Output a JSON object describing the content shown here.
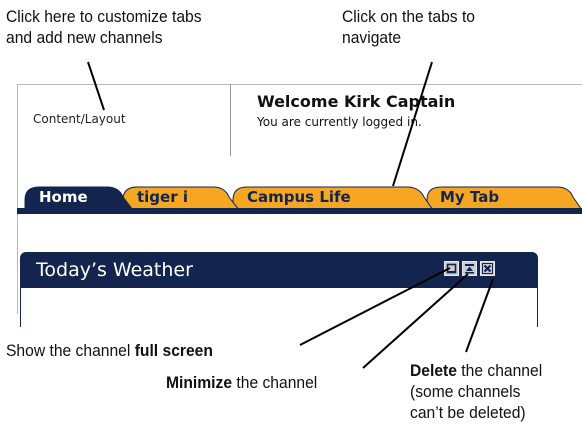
{
  "annotations": {
    "customize": [
      "Click here to customize tabs",
      "and add new channels"
    ],
    "navigate": [
      "Click on the tabs to",
      "navigate"
    ],
    "full_screen": {
      "prefix": "Show the channel ",
      "bold": "full screen"
    },
    "minimize": {
      "bold": "Minimize",
      "suffix": " the channel"
    },
    "delete": {
      "bold": "Delete",
      "suffix": " the channel",
      "line2": "(some channels",
      "line3": "can’t be deleted)"
    }
  },
  "header": {
    "content_layout_link": "Content/Layout",
    "welcome": "Welcome Kirk Captain",
    "status": "You are currently logged in."
  },
  "tabs": [
    {
      "label": "Home",
      "active": true
    },
    {
      "label": "tiger i",
      "active": false
    },
    {
      "label": "Campus Life",
      "active": false
    },
    {
      "label": "My Tab",
      "active": false
    }
  ],
  "channel": {
    "title": "Today’s Weather",
    "buttons": [
      "full-screen-icon",
      "minimize-icon",
      "close-icon"
    ]
  },
  "colors": {
    "navy": "#13254f",
    "tab_orange": "#f5a623",
    "callout_line": "#000000"
  }
}
